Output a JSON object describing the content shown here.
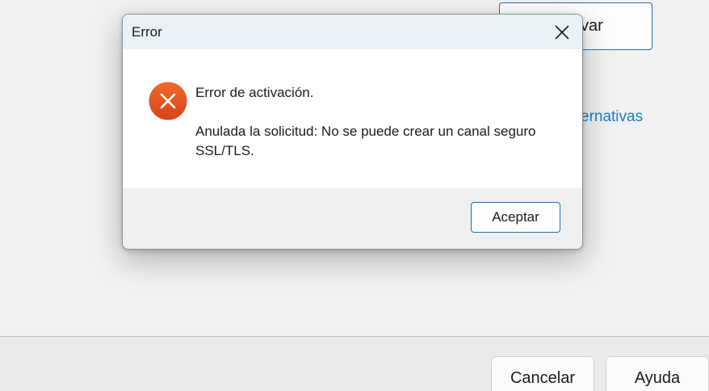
{
  "background": {
    "activate_button_label": "var",
    "alternatives_link": "ernativas",
    "cancel_label": "Cancelar",
    "help_label": "Ayuda"
  },
  "dialog": {
    "title": "Error",
    "close_icon": "close-icon",
    "status_icon": "error-icon",
    "message_title": "Error de activación.",
    "message_detail": "Anulada la solicitud: No se puede crear un canal seguro SSL/TLS.",
    "ok_label": "Aceptar"
  },
  "colors": {
    "error_icon": "#e3501c",
    "accent_border": "#1f70b3",
    "link": "#1a7fc1",
    "titlebar": "#e9f3f7"
  }
}
